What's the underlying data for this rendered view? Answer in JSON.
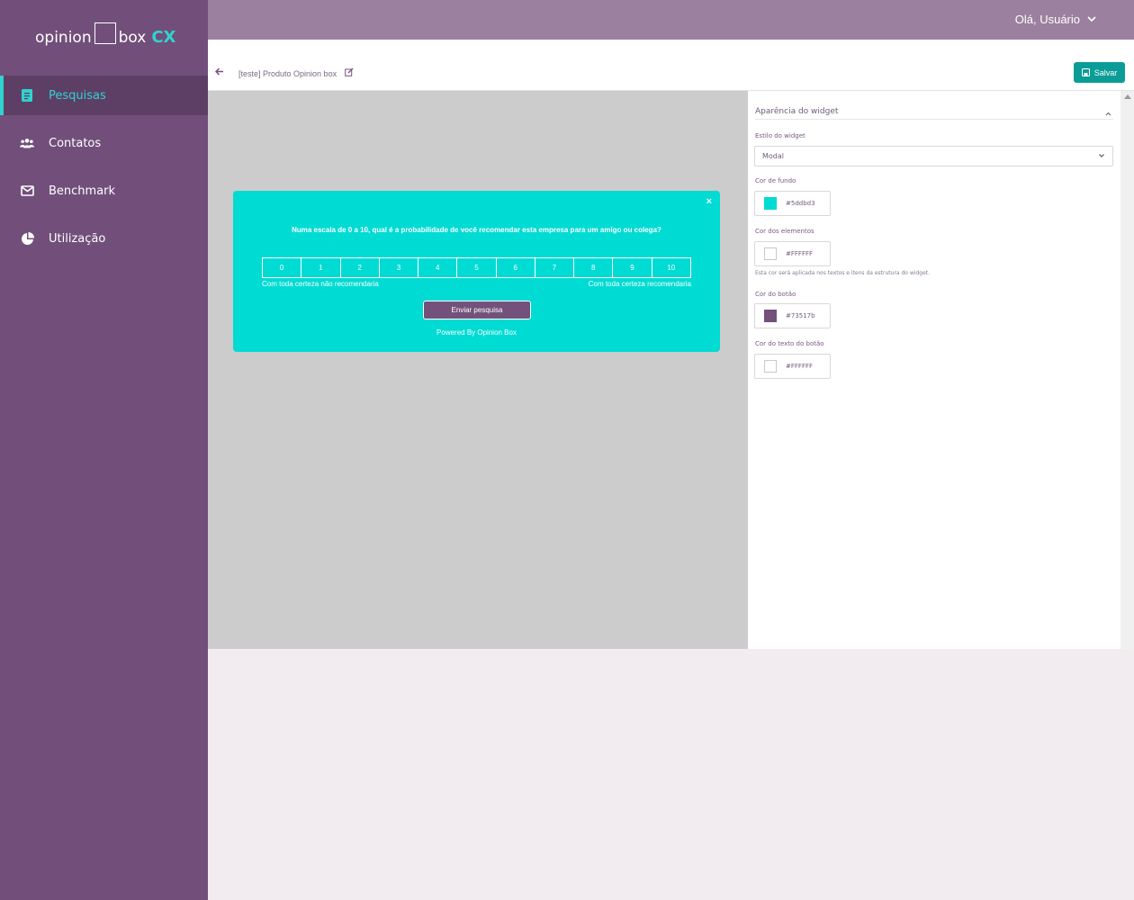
{
  "brand": {
    "word1": "opinion",
    "word2": "box",
    "suffix": "CX"
  },
  "sidebar": {
    "items": [
      {
        "label": "Pesquisas",
        "icon": "survey-icon",
        "active": true
      },
      {
        "label": "Contatos",
        "icon": "users-icon",
        "active": false
      },
      {
        "label": "Benchmark",
        "icon": "mail-icon",
        "active": false
      },
      {
        "label": "Utilização",
        "icon": "pie-chart-icon",
        "active": false
      }
    ]
  },
  "header": {
    "greeting": "Olá, Usuário"
  },
  "toolbar": {
    "breadcrumb": "[teste] Produto Opinion box",
    "save_label": "Salvar"
  },
  "widget": {
    "question": "Numa escala de 0 a 10, qual é a probabilidade de você recomendar esta empresa para um amigo ou colega?",
    "scale": [
      "0",
      "1",
      "2",
      "3",
      "4",
      "5",
      "6",
      "7",
      "8",
      "9",
      "10"
    ],
    "low_label": "Com toda certeza não recomendaria",
    "high_label": "Com toda certeza recomendaria",
    "submit_label": "Enviar pesquisa",
    "powered_by": "Powered By Opinion Box",
    "close_symbol": "×"
  },
  "panel": {
    "section_title": "Aparência do widget",
    "style_label": "Estilo do widget",
    "style_value": "Modal",
    "bg_label": "Cor de fundo",
    "bg_value": "#5ddbd3",
    "elements_label": "Cor dos elementos",
    "elements_value": "#FFFFFF",
    "elements_hint": "Esta cor será aplicada nos textos e itens da estrutura do widget.",
    "button_label": "Cor do botão",
    "button_value": "#73517b",
    "button_text_label": "Cor do texto do botão",
    "button_text_value": "#FFFFFF"
  },
  "colors": {
    "sidebar": "#724f7a",
    "accent": "#2fd3cf",
    "widget_bg": "#00dbd3",
    "button": "#73517b",
    "save": "#0a9d97"
  }
}
